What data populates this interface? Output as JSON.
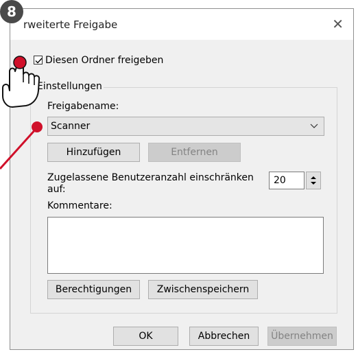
{
  "step_badge": "8",
  "dialog": {
    "title": "rweiterte Freigabe",
    "close_glyph": "✕",
    "share_checkbox": {
      "label": "Diesen Ordner freigeben",
      "checked": true
    },
    "settings": {
      "group_label": "Einstellungen",
      "share_name_label": "Freigabename:",
      "share_name_value": "Scanner",
      "add_button": "Hinzufügen",
      "remove_button": "Entfernen",
      "user_limit_label_line1": "Zugelassene Benutzeranzahl einschränken",
      "user_limit_label_line2": "auf:",
      "user_limit_value": "20",
      "comments_label": "Kommentare:",
      "comments_value": "",
      "permissions_button": "Berechtigungen",
      "caching_button": "Zwischenspeichern"
    },
    "footer": {
      "ok_button": "OK",
      "cancel_button": "Abbrechen",
      "apply_button": "Übernehmen"
    }
  },
  "icons": {
    "close": "close-icon",
    "checkmark": "checkmark-icon",
    "dropdown": "chevron-down-icon",
    "spinner": "spinner-arrows-icon",
    "pointer": "hand-pointer-icon"
  },
  "colors": {
    "dialog_bg": "#f0f0f0",
    "annotation_red": "#d0102a",
    "badge_bg": "#4a4a4a"
  }
}
